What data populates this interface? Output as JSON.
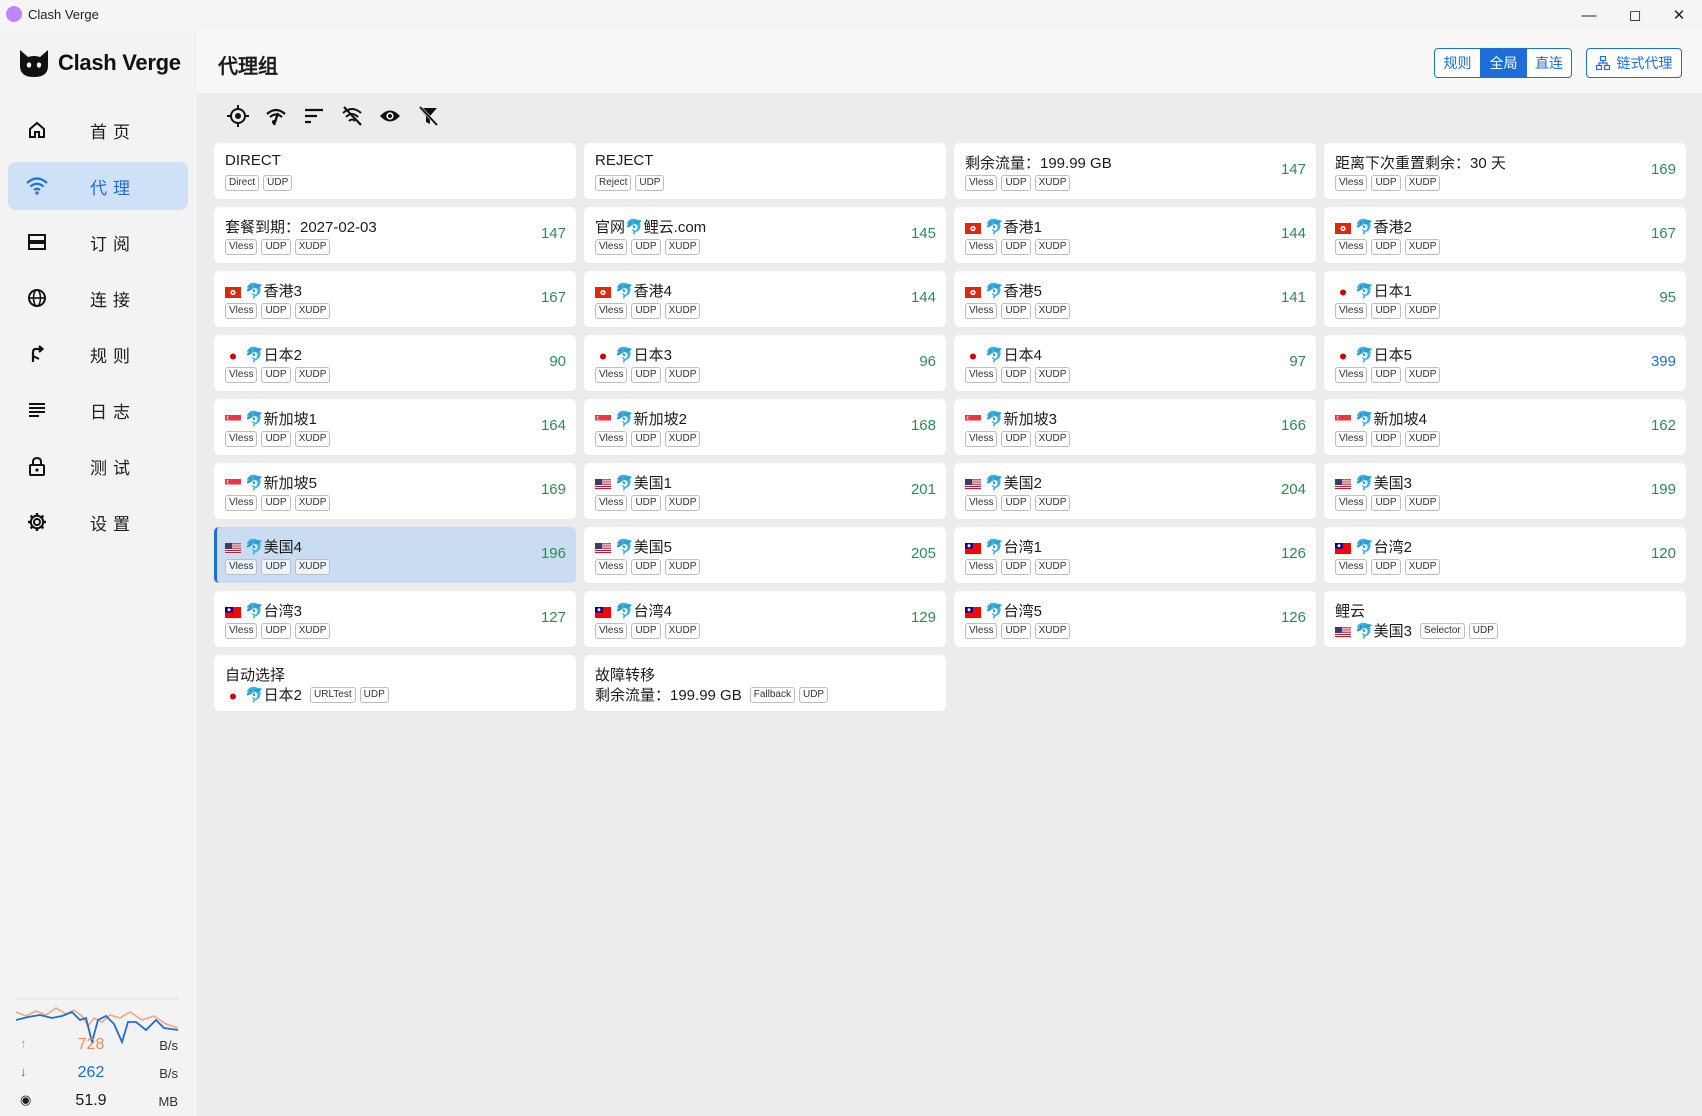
{
  "window": {
    "title": "Clash Verge"
  },
  "sidebar": {
    "brand": "Clash Verge",
    "items": [
      {
        "label": "首页",
        "icon": "home-icon",
        "active": false
      },
      {
        "label": "代理",
        "icon": "wifi-icon",
        "active": true
      },
      {
        "label": "订阅",
        "icon": "storage-icon",
        "active": false
      },
      {
        "label": "连接",
        "icon": "globe-icon",
        "active": false
      },
      {
        "label": "规则",
        "icon": "fork-icon",
        "active": false
      },
      {
        "label": "日志",
        "icon": "list-icon",
        "active": false
      },
      {
        "label": "测试",
        "icon": "lock-icon",
        "active": false
      },
      {
        "label": "设置",
        "icon": "gear-icon",
        "active": false
      }
    ],
    "traffic": {
      "upload": {
        "value": "728",
        "unit": "B/s"
      },
      "download": {
        "value": "262",
        "unit": "B/s"
      },
      "memory": {
        "value": "51.9",
        "unit": "MB"
      }
    }
  },
  "header": {
    "title": "代理组",
    "modes": [
      "规则",
      "全局",
      "直连"
    ],
    "active_mode": "全局",
    "chain_label": "链式代理"
  },
  "toolbar": [
    "locate-icon",
    "speed-test-icon",
    "sort-icon",
    "hide-unavailable-icon",
    "eye-icon",
    "filter-icon"
  ],
  "colors": {
    "accent": "#1d6ed6",
    "delay_good": "#2e8b57"
  },
  "proxies": [
    {
      "name": "DIRECT",
      "tags": [
        "Direct",
        "UDP"
      ],
      "delay": ""
    },
    {
      "name": "REJECT",
      "tags": [
        "Reject",
        "UDP"
      ],
      "delay": ""
    },
    {
      "name": "剩余流量：199.99 GB",
      "tags": [
        "Vless",
        "UDP",
        "XUDP"
      ],
      "delay": "147"
    },
    {
      "name": "距离下次重置剩余：30 天",
      "tags": [
        "Vless",
        "UDP",
        "XUDP"
      ],
      "delay": "169"
    },
    {
      "name": "套餐到期：2027-02-03",
      "tags": [
        "Vless",
        "UDP",
        "XUDP"
      ],
      "delay": "147"
    },
    {
      "name": "官网🐬鲤云.com",
      "tags": [
        "Vless",
        "UDP",
        "XUDP"
      ],
      "delay": "145"
    },
    {
      "name": "🐬香港1",
      "flag": "hk",
      "tags": [
        "Vless",
        "UDP",
        "XUDP"
      ],
      "delay": "144"
    },
    {
      "name": "🐬香港2",
      "flag": "hk",
      "tags": [
        "Vless",
        "UDP",
        "XUDP"
      ],
      "delay": "167"
    },
    {
      "name": "🐬香港3",
      "flag": "hk",
      "tags": [
        "Vless",
        "UDP",
        "XUDP"
      ],
      "delay": "167"
    },
    {
      "name": "🐬香港4",
      "flag": "hk",
      "tags": [
        "Vless",
        "UDP",
        "XUDP"
      ],
      "delay": "144"
    },
    {
      "name": "🐬香港5",
      "flag": "hk",
      "tags": [
        "Vless",
        "UDP",
        "XUDP"
      ],
      "delay": "141"
    },
    {
      "name": "🐬日本1",
      "flag": "jp",
      "tags": [
        "Vless",
        "UDP",
        "XUDP"
      ],
      "delay": "95"
    },
    {
      "name": "🐬日本2",
      "flag": "jp",
      "tags": [
        "Vless",
        "UDP",
        "XUDP"
      ],
      "delay": "90"
    },
    {
      "name": "🐬日本3",
      "flag": "jp",
      "tags": [
        "Vless",
        "UDP",
        "XUDP"
      ],
      "delay": "96"
    },
    {
      "name": "🐬日本4",
      "flag": "jp",
      "tags": [
        "Vless",
        "UDP",
        "XUDP"
      ],
      "delay": "97"
    },
    {
      "name": "🐬日本5",
      "flag": "jp",
      "tags": [
        "Vless",
        "UDP",
        "XUDP"
      ],
      "delay": "399",
      "delay_color": "blue"
    },
    {
      "name": "🐬新加坡1",
      "flag": "sg",
      "tags": [
        "Vless",
        "UDP",
        "XUDP"
      ],
      "delay": "164"
    },
    {
      "name": "🐬新加坡2",
      "flag": "sg",
      "tags": [
        "Vless",
        "UDP",
        "XUDP"
      ],
      "delay": "168"
    },
    {
      "name": "🐬新加坡3",
      "flag": "sg",
      "tags": [
        "Vless",
        "UDP",
        "XUDP"
      ],
      "delay": "166"
    },
    {
      "name": "🐬新加坡4",
      "flag": "sg",
      "tags": [
        "Vless",
        "UDP",
        "XUDP"
      ],
      "delay": "162"
    },
    {
      "name": "🐬新加坡5",
      "flag": "sg",
      "tags": [
        "Vless",
        "UDP",
        "XUDP"
      ],
      "delay": "169"
    },
    {
      "name": "🐬美国1",
      "flag": "us",
      "tags": [
        "Vless",
        "UDP",
        "XUDP"
      ],
      "delay": "201"
    },
    {
      "name": "🐬美国2",
      "flag": "us",
      "tags": [
        "Vless",
        "UDP",
        "XUDP"
      ],
      "delay": "204"
    },
    {
      "name": "🐬美国3",
      "flag": "us",
      "tags": [
        "Vless",
        "UDP",
        "XUDP"
      ],
      "delay": "199"
    },
    {
      "name": "🐬美国4",
      "flag": "us",
      "tags": [
        "Vless",
        "UDP",
        "XUDP"
      ],
      "delay": "196",
      "selected": true
    },
    {
      "name": "🐬美国5",
      "flag": "us",
      "tags": [
        "Vless",
        "UDP",
        "XUDP"
      ],
      "delay": "205"
    },
    {
      "name": "🐬台湾1",
      "flag": "tw",
      "tags": [
        "Vless",
        "UDP",
        "XUDP"
      ],
      "delay": "126"
    },
    {
      "name": "🐬台湾2",
      "flag": "tw",
      "tags": [
        "Vless",
        "UDP",
        "XUDP"
      ],
      "delay": "120"
    },
    {
      "name": "🐬台湾3",
      "flag": "tw",
      "tags": [
        "Vless",
        "UDP",
        "XUDP"
      ],
      "delay": "127"
    },
    {
      "name": "🐬台湾4",
      "flag": "tw",
      "tags": [
        "Vless",
        "UDP",
        "XUDP"
      ],
      "delay": "129"
    },
    {
      "name": "🐬台湾5",
      "flag": "tw",
      "tags": [
        "Vless",
        "UDP",
        "XUDP"
      ],
      "delay": "126"
    },
    {
      "name": "鲤云",
      "group": true,
      "current": "🐬美国3",
      "current_flag": "us",
      "tags": [
        "Selector",
        "UDP"
      ],
      "delay": ""
    },
    {
      "name": "自动选择",
      "group": true,
      "current": "🐬日本2",
      "current_flag": "jp",
      "tags": [
        "URLTest",
        "UDP"
      ],
      "delay": ""
    },
    {
      "name": "故障转移",
      "group": true,
      "current": "剩余流量：199.99 GB",
      "tags": [
        "Fallback",
        "UDP"
      ],
      "delay": ""
    }
  ]
}
